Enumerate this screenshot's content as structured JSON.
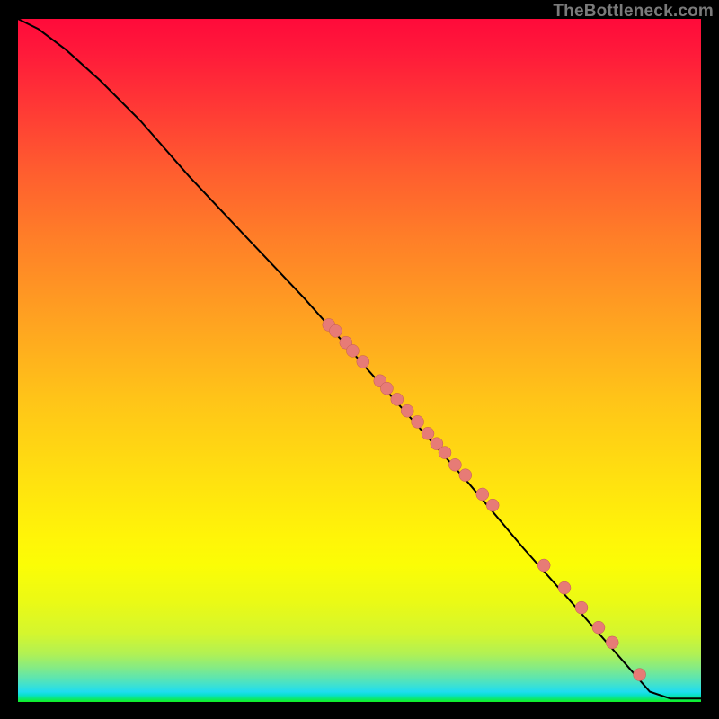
{
  "watermark": "TheBottleneck.com",
  "colors": {
    "background": "#000000",
    "curve_stroke": "#000000",
    "marker_fill": "#e77b76",
    "marker_stroke": "#c25a55"
  },
  "chart_data": {
    "type": "line",
    "title": "",
    "xlabel": "",
    "ylabel": "",
    "xlim": [
      0,
      100
    ],
    "ylim": [
      0,
      100
    ],
    "grid": false,
    "legend": false,
    "series": [
      {
        "name": "bottleneck-curve",
        "x_norm": [
          0.0,
          0.03,
          0.07,
          0.12,
          0.18,
          0.25,
          0.33,
          0.42,
          0.5,
          0.58,
          0.66,
          0.74,
          0.82,
          0.89,
          0.925,
          0.955,
          1.0
        ],
        "y_norm": [
          1.0,
          0.985,
          0.955,
          0.91,
          0.85,
          0.77,
          0.685,
          0.59,
          0.5,
          0.41,
          0.32,
          0.225,
          0.135,
          0.055,
          0.015,
          0.005,
          0.005
        ]
      }
    ],
    "markers": {
      "name": "highlight-points",
      "x_norm": [
        0.455,
        0.465,
        0.48,
        0.49,
        0.505,
        0.53,
        0.54,
        0.555,
        0.57,
        0.585,
        0.6,
        0.613,
        0.625,
        0.64,
        0.655,
        0.68,
        0.695,
        0.77,
        0.8,
        0.825,
        0.85,
        0.87,
        0.91
      ],
      "y_norm": [
        0.552,
        0.543,
        0.526,
        0.514,
        0.498,
        0.47,
        0.459,
        0.443,
        0.426,
        0.41,
        0.393,
        0.378,
        0.365,
        0.347,
        0.332,
        0.304,
        0.288,
        0.2,
        0.167,
        0.138,
        0.109,
        0.087,
        0.04
      ],
      "radius_px": 7
    }
  }
}
